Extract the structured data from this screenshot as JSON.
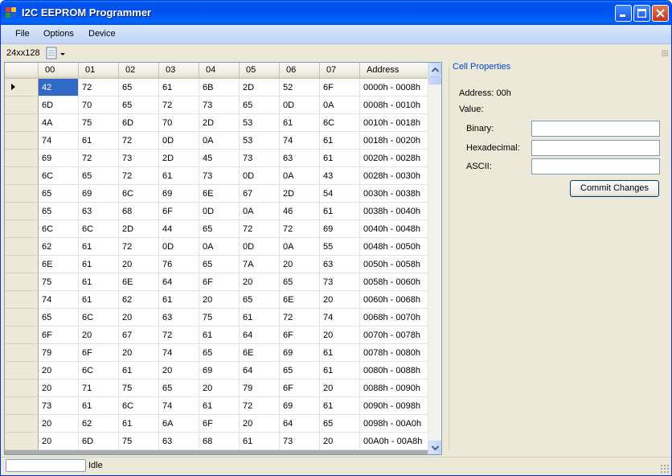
{
  "window": {
    "title": "I2C EEPROM Programmer"
  },
  "menu": {
    "items": [
      "File",
      "Options",
      "Device"
    ]
  },
  "toolbar": {
    "device_label": "24xx128",
    "device_icon": "document-icon"
  },
  "grid": {
    "columns": [
      "00",
      "01",
      "02",
      "03",
      "04",
      "05",
      "06",
      "07",
      "Address"
    ],
    "rows": [
      [
        "42",
        "72",
        "65",
        "61",
        "6B",
        "2D",
        "52",
        "6F",
        "0000h - 0008h"
      ],
      [
        "6D",
        "70",
        "65",
        "72",
        "73",
        "65",
        "0D",
        "0A",
        "0008h - 0010h"
      ],
      [
        "4A",
        "75",
        "6D",
        "70",
        "2D",
        "53",
        "61",
        "6C",
        "0010h - 0018h"
      ],
      [
        "74",
        "61",
        "72",
        "0D",
        "0A",
        "53",
        "74",
        "61",
        "0018h - 0020h"
      ],
      [
        "69",
        "72",
        "73",
        "2D",
        "45",
        "73",
        "63",
        "61",
        "0020h - 0028h"
      ],
      [
        "6C",
        "65",
        "72",
        "61",
        "73",
        "0D",
        "0A",
        "43",
        "0028h - 0030h"
      ],
      [
        "65",
        "69",
        "6C",
        "69",
        "6E",
        "67",
        "2D",
        "54",
        "0030h - 0038h"
      ],
      [
        "65",
        "63",
        "68",
        "6F",
        "0D",
        "0A",
        "46",
        "61",
        "0038h - 0040h"
      ],
      [
        "6C",
        "6C",
        "2D",
        "44",
        "65",
        "72",
        "72",
        "69",
        "0040h - 0048h"
      ],
      [
        "62",
        "61",
        "72",
        "0D",
        "0A",
        "0D",
        "0A",
        "55",
        "0048h - 0050h"
      ],
      [
        "6E",
        "61",
        "20",
        "76",
        "65",
        "7A",
        "20",
        "63",
        "0050h - 0058h"
      ],
      [
        "75",
        "61",
        "6E",
        "64",
        "6F",
        "20",
        "65",
        "73",
        "0058h - 0060h"
      ],
      [
        "74",
        "61",
        "62",
        "61",
        "20",
        "65",
        "6E",
        "20",
        "0060h - 0068h"
      ],
      [
        "65",
        "6C",
        "20",
        "63",
        "75",
        "61",
        "72",
        "74",
        "0068h - 0070h"
      ],
      [
        "6F",
        "20",
        "67",
        "72",
        "61",
        "64",
        "6F",
        "20",
        "0070h - 0078h"
      ],
      [
        "79",
        "6F",
        "20",
        "74",
        "65",
        "6E",
        "69",
        "61",
        "0078h - 0080h"
      ],
      [
        "20",
        "6C",
        "61",
        "20",
        "69",
        "64",
        "65",
        "61",
        "0080h - 0088h"
      ],
      [
        "20",
        "71",
        "75",
        "65",
        "20",
        "79",
        "6F",
        "20",
        "0088h - 0090h"
      ],
      [
        "73",
        "61",
        "6C",
        "74",
        "61",
        "72",
        "69",
        "61",
        "0090h - 0098h"
      ],
      [
        "20",
        "62",
        "61",
        "6A",
        "6F",
        "20",
        "64",
        "65",
        "0098h - 00A0h"
      ],
      [
        "20",
        "6D",
        "75",
        "63",
        "68",
        "61",
        "73",
        "20",
        "00A0h - 00A8h"
      ]
    ]
  },
  "cell_properties": {
    "title": "Cell Properties",
    "address": "Address: 00h",
    "value_label": "Value:",
    "binary_label": "Binary:",
    "hex_label": "Hexadecimal:",
    "ascii_label": "ASCII:",
    "binary_value": "",
    "hex_value": "",
    "ascii_value": "",
    "commit_label": "Commit Changes"
  },
  "status": {
    "text": "Idle",
    "progress": 0
  },
  "colors": {
    "accent": "#316ac5",
    "groupbox_title": "#0046d5",
    "titlebar": "#0053ee"
  }
}
